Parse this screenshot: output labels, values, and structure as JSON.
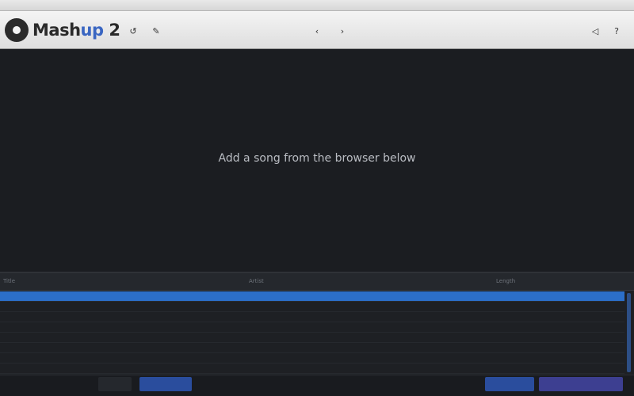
{
  "os": {
    "app_name": "",
    "window_title": ""
  },
  "app": {
    "logo_main": "Mash",
    "logo_accent": "up",
    "logo_version": " 2"
  },
  "toolbar": {
    "icons": [
      "undo-icon",
      "pen-icon",
      "back-icon",
      "forward-icon",
      "volume-icon",
      "help-icon"
    ],
    "undo": "↺",
    "pen": "✎",
    "prev": "‹",
    "next": "›",
    "vol": "◁",
    "help": "?"
  },
  "stage": {
    "message": "Add a song from the browser below"
  },
  "browser": {
    "columns": [
      "Title",
      "Artist",
      "Length",
      "",
      ""
    ],
    "rows": [
      {
        "title": "",
        "artist": "",
        "length": "",
        "play": "",
        "selected": true
      },
      {
        "title": "",
        "artist": "",
        "length": "",
        "play": "",
        "selected": false
      },
      {
        "title": "",
        "artist": "",
        "length": "",
        "play": "",
        "selected": false
      },
      {
        "title": "",
        "artist": "",
        "length": "",
        "play": "",
        "selected": false
      },
      {
        "title": "",
        "artist": "",
        "length": "",
        "play": "",
        "selected": false
      },
      {
        "title": "",
        "artist": "",
        "length": "",
        "play": "",
        "selected": false
      },
      {
        "title": "",
        "artist": "",
        "length": "",
        "play": "",
        "selected": false
      },
      {
        "title": "",
        "artist": "",
        "length": "",
        "play": "",
        "selected": false
      }
    ]
  },
  "bottom": {
    "left": "",
    "browse": "",
    "blue": "",
    "blue2": "",
    "last": ""
  },
  "colors": {
    "selection": "#2c6fc9",
    "accent": "#3a66c2",
    "stage_bg": "#1b1d21"
  }
}
